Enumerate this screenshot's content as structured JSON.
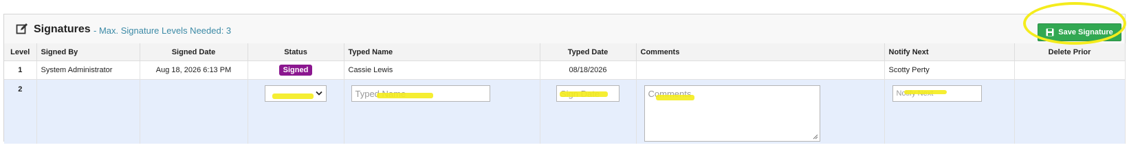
{
  "header": {
    "title": "Signatures",
    "subtitle": "- Max. Signature Levels Needed: 3",
    "save_label": "Save Signature"
  },
  "columns": [
    "Level",
    "Signed By",
    "Signed Date",
    "Status",
    "Typed Name",
    "Typed Date",
    "Comments",
    "Notify Next",
    "Delete Prior"
  ],
  "rows": [
    {
      "level": "1",
      "signed_by": "System Administrator",
      "signed_date": "Aug 18, 2026 6:13 PM",
      "status": "Signed",
      "typed_name": "Cassie Lewis",
      "typed_date": "08/18/2026",
      "comments": "",
      "notify_next": "Scotty Perty",
      "delete_prior": ""
    },
    {
      "level": "2",
      "status_selected": "",
      "typed_name_placeholder": "Typed Name",
      "sign_date_placeholder": "Sign Date",
      "comments_placeholder": "Comments",
      "notify_next_placeholder": "Notify Next"
    }
  ],
  "colors": {
    "accent_subtitle": "#3c8aa6",
    "save_button": "#32a852",
    "signed_badge": "#8b178f",
    "highlight": "#f4ec1d",
    "edit_row": "#e6eefc"
  },
  "icons": {
    "header": "edit-icon",
    "save": "floppy-disk-icon",
    "select": "chevron-down-icon"
  }
}
